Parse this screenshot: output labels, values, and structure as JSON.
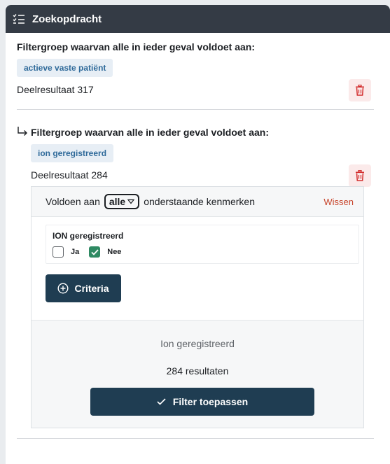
{
  "header": {
    "title": "Zoekopdracht",
    "icon": "checklist-icon"
  },
  "group1": {
    "title": "Filtergroep waarvan alle in ieder geval voldoet aan:",
    "chip": "actieve vaste patiënt",
    "subresult": "Deelresultaat 317"
  },
  "group2": {
    "title": "Filtergroep waarvan alle in ieder geval voldoet aan:",
    "chip": "ion geregistreerd",
    "subresult": "Deelresultaat 284",
    "filter": {
      "prefix": "Voldoen aan",
      "select_value": "alle",
      "suffix": "onderstaande kenmerken",
      "clear_label": "Wissen",
      "criterion": {
        "label": "ION geregistreerd",
        "options": [
          {
            "label": "Ja",
            "checked": false
          },
          {
            "label": "Nee",
            "checked": true
          }
        ]
      },
      "criteria_button": "Criteria",
      "summary_label": "Ion geregistreerd",
      "result_count": "284 resultaten",
      "apply_button": "Filter toepassen"
    }
  },
  "colors": {
    "header_bg": "#343b45",
    "primary_button": "#1f3d52",
    "chip_bg": "#e7eef5",
    "chip_text": "#2f6a9a",
    "danger": "#d32f2f",
    "checkbox_checked": "#2f8a63",
    "clear_link": "#c8472e"
  }
}
